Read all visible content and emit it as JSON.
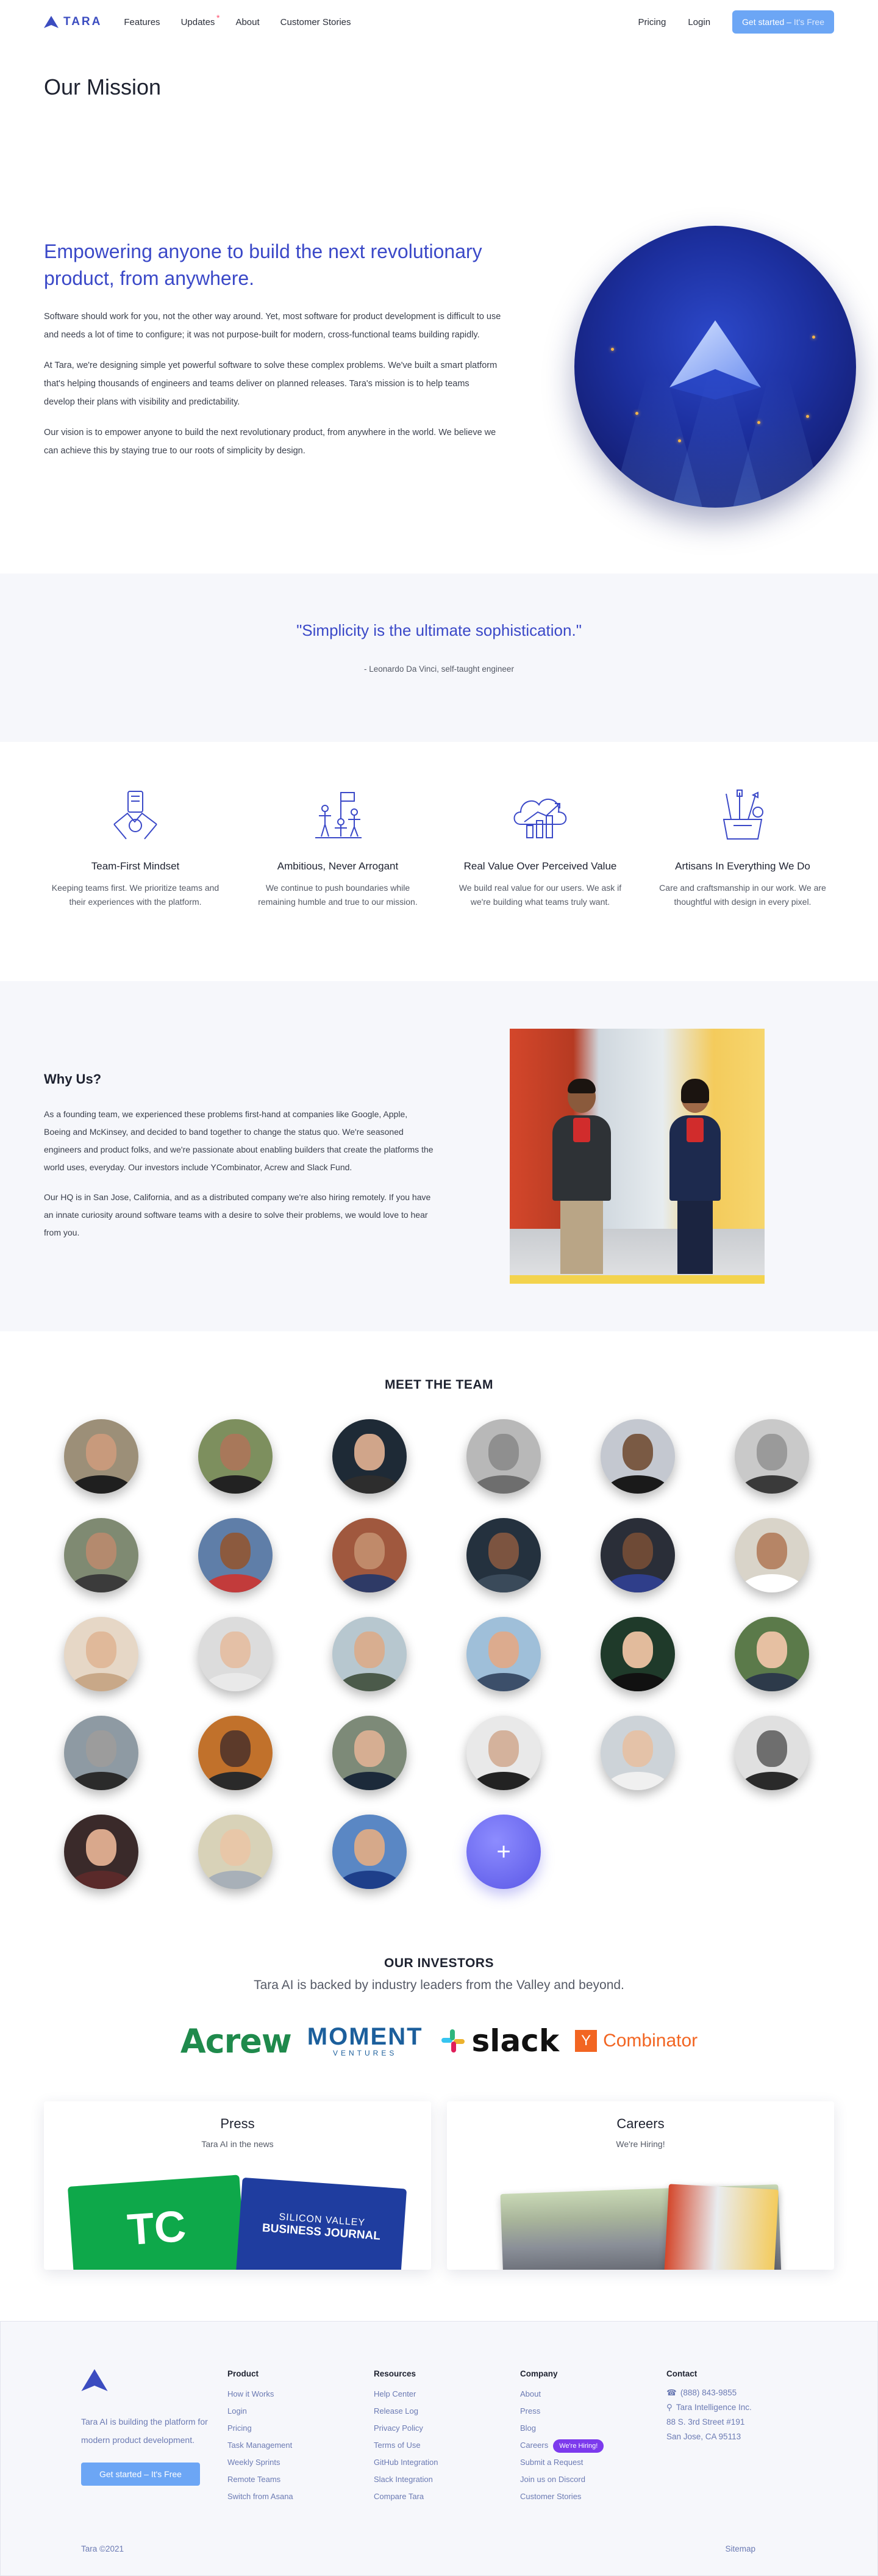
{
  "nav": {
    "brand": "TARA",
    "links": [
      "Features",
      "Updates",
      "About",
      "Customer Stories"
    ],
    "updates_badge": "*",
    "pricing": "Pricing",
    "login": "Login",
    "cta_main": "Get started –",
    "cta_dim": "It's Free"
  },
  "mission": {
    "title": "Our Mission",
    "heading": "Empowering anyone to build the next revolutionary product, from anywhere.",
    "p1": "Software should work for you, not the other way around. Yet, most software for product development is difficult to use and needs a lot of time to configure; it was not purpose-built for modern, cross-functional teams building rapidly.",
    "p2": "At Tara, we're designing simple yet powerful software to solve these complex problems. We've built a smart platform that's helping thousands of engineers and teams deliver on planned releases. Tara's mission is to help teams develop their plans with visibility and predictability.",
    "p3": "Our vision is to empower anyone to build the next revolutionary product, from anywhere in the world. We believe we can achieve this by staying true to our roots of simplicity by design."
  },
  "quote": {
    "text": "\"Simplicity is the ultimate sophistication.\"",
    "author": "- Leonardo Da Vinci, self-taught engineer"
  },
  "values": [
    {
      "icon": "teamwork-icon",
      "title": "Team-First Mindset",
      "desc": "Keeping teams first. We prioritize teams and their experiences with the platform."
    },
    {
      "icon": "summit-flag-icon",
      "title": "Ambitious, Never Arrogant",
      "desc": "We continue to push boundaries while remaining humble and true to our mission."
    },
    {
      "icon": "cloud-growth-icon",
      "title": "Real Value Over Perceived Value",
      "desc": "We build real value for our users. We ask if we're building what teams truly want."
    },
    {
      "icon": "design-tools-icon",
      "title": "Artisans In Everything We Do",
      "desc": "Care and craftsmanship in our work. We are thoughtful with design in every pixel."
    }
  ],
  "why": {
    "title": "Why Us?",
    "p1": "As a founding team, we experienced these problems first-hand at companies like Google, Apple, Boeing and McKinsey, and decided to band together to change the status quo. We're seasoned engineers and product folks, and we're passionate about enabling builders that create the platforms the world uses, everyday. Our investors include YCombinator, Acrew and Slack Fund.",
    "p2": "Our HQ is in San Jose, California, and as a distributed company we're also hiring remotely. If you have an innate curiosity around software teams with a desire to solve their problems, we would love to hear from you."
  },
  "team": {
    "title": "MEET THE TEAM",
    "members": [
      {
        "bg": "#9c8f78",
        "skin": "#c89a7c",
        "shirt": "#1f1f1f"
      },
      {
        "bg": "#7d8f5e",
        "skin": "#a8785a",
        "shirt": "#222222"
      },
      {
        "bg": "#1e2a36",
        "skin": "#d0a58a",
        "shirt": "#2d2d2d"
      },
      {
        "bg": "#b8b8b8",
        "skin": "#8f8f8f",
        "shirt": "#6e6e6e"
      },
      {
        "bg": "#c4c8d0",
        "skin": "#7a5a44",
        "shirt": "#1a1a1a"
      },
      {
        "bg": "#c9c9c9",
        "skin": "#9a9a9a",
        "shirt": "#3a3a3a"
      },
      {
        "bg": "#7f8a72",
        "skin": "#b48a6e",
        "shirt": "#3b3b3b"
      },
      {
        "bg": "#5f7ea8",
        "skin": "#8c5a3e",
        "shirt": "#c23b3b"
      },
      {
        "bg": "#a0583e",
        "skin": "#c08a6a",
        "shirt": "#2e3a66"
      },
      {
        "bg": "#24313e",
        "skin": "#7c5440",
        "shirt": "#3a4a5a"
      },
      {
        "bg": "#2a2e38",
        "skin": "#6e4a36",
        "shirt": "#2f3e8a"
      },
      {
        "bg": "#d9d4c9",
        "skin": "#b68566",
        "shirt": "#ffffff"
      },
      {
        "bg": "#e6d7c6",
        "skin": "#e0b99a",
        "shirt": "#c8a888"
      },
      {
        "bg": "#dcdcdc",
        "skin": "#e4c0a6",
        "shirt": "#e9e9e9"
      },
      {
        "bg": "#b7c7cf",
        "skin": "#d8ae90",
        "shirt": "#4b5a4a"
      },
      {
        "bg": "#9fbfd9",
        "skin": "#dcab8e",
        "shirt": "#3c4f6a"
      },
      {
        "bg": "#1f3a2a",
        "skin": "#e2bb9c",
        "shirt": "#111111"
      },
      {
        "bg": "#5b7a4a",
        "skin": "#e6c0a2",
        "shirt": "#2d3a4a"
      },
      {
        "bg": "#8e9aa3",
        "skin": "#9c9c9c",
        "shirt": "#2b2b2b"
      },
      {
        "bg": "#c1712b",
        "skin": "#5c3a2a",
        "shirt": "#2a2a2a"
      },
      {
        "bg": "#7d8a78",
        "skin": "#d6ae92",
        "shirt": "#1c2a3a"
      },
      {
        "bg": "#e9e9e9",
        "skin": "#d4b29c",
        "shirt": "#222222"
      },
      {
        "bg": "#cdd3d8",
        "skin": "#e4c2a8",
        "shirt": "#f0f0f0"
      },
      {
        "bg": "#e0e0e0",
        "skin": "#6e6e6e",
        "shirt": "#2a2a2a"
      },
      {
        "bg": "#3a2a2a",
        "skin": "#d9a88c",
        "shirt": "#5a2a2a"
      },
      {
        "bg": "#d8d2b8",
        "skin": "#e8c7a8",
        "shirt": "#a8b0b8"
      },
      {
        "bg": "#5a87c4",
        "skin": "#d6a98a",
        "shirt": "#1e3f8a"
      }
    ],
    "add_label": "+"
  },
  "investors": {
    "title": "OUR INVESTORS",
    "subtitle": "Tara AI is backed by industry leaders from the Valley and beyond.",
    "acrew": "Acrew",
    "moment_big": "MOMENT",
    "moment_small": "VENTURES",
    "slack": "slack",
    "yc_letter": "Y",
    "yc_word": "Combinator"
  },
  "cards": {
    "press_title": "Press",
    "press_sub": "Tara AI in the news",
    "tc": "TC",
    "sv_l1": "SILICON VALLEY",
    "sv_l2": "BUSINESS JOURNAL",
    "careers_title": "Careers",
    "careers_sub": "We're Hiring!"
  },
  "footer": {
    "tagline": "Tara AI is building the platform for modern product development.",
    "cta": "Get started – It's Free",
    "product_head": "Product",
    "product": [
      "How it Works",
      "Login",
      "Pricing",
      "Task Management",
      "Weekly Sprints",
      "Remote Teams",
      "Switch from Asana"
    ],
    "resources_head": "Resources",
    "resources": [
      "Help Center",
      "Release Log",
      "Privacy Policy",
      "Terms of Use",
      "GitHub Integration",
      "Slack Integration",
      "Compare Tara"
    ],
    "company_head": "Company",
    "company": [
      "About",
      "Press",
      "Blog",
      "Careers",
      "Submit a Request",
      "Join us on Discord",
      "Customer Stories"
    ],
    "hiring_badge": "We're Hiring!",
    "contact_head": "Contact",
    "phone": "(888) 843-9855",
    "company_name": "Tara Intelligence Inc.",
    "street": "88 S. 3rd Street #191",
    "city": "San Jose, CA 95113",
    "copyright": "Tara ©2021",
    "sitemap": "Sitemap"
  },
  "colors": {
    "accent": "#3b49c8",
    "cta": "#6ca6f5",
    "hiring": "#7c3aed"
  }
}
